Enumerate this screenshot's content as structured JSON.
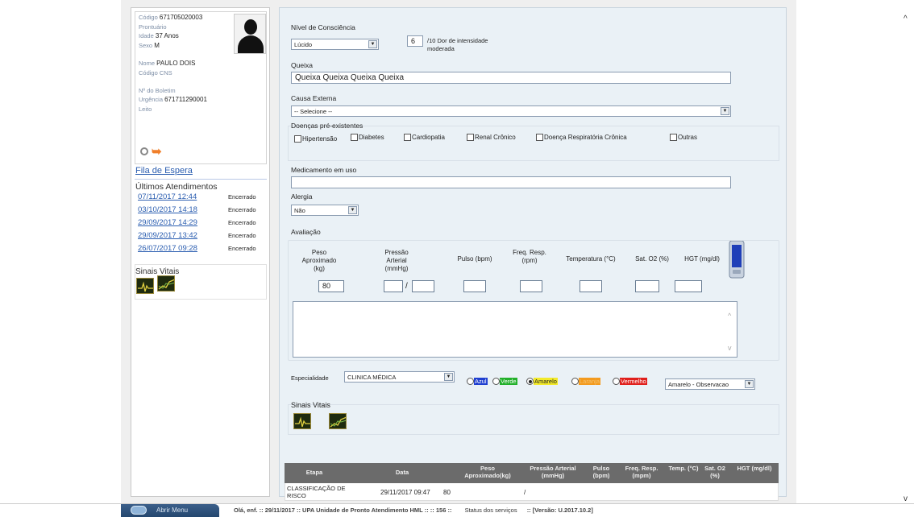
{
  "patient": {
    "codigo_label": "Código",
    "codigo": "671705020003",
    "prontuario_label": "Prontuário",
    "idade_label": "Idade",
    "idade": "37 Anos",
    "sexo_label": "Sexo",
    "sexo": "M",
    "nome_label": "Nome",
    "nome": "PAULO DOIS",
    "cns_label": "Código CNS",
    "boletim_label": "Nº do Boletim",
    "urgencia_label": "Urgência",
    "urgencia": "671711290001",
    "leito_label": "Leito"
  },
  "fila_label": "Fila de Espera",
  "ultimos": {
    "title": "Últimos Atendimentos",
    "items": [
      {
        "date": "07/11/2017 12:44",
        "status": "Encerrado"
      },
      {
        "date": "03/10/2017 14:18",
        "status": "Encerrado"
      },
      {
        "date": "29/09/2017 14:29",
        "status": "Encerrado"
      },
      {
        "date": "29/09/2017 13:42",
        "status": "Encerrado"
      },
      {
        "date": "26/07/2017 09:28",
        "status": "Encerrado"
      }
    ]
  },
  "sinais_label": "Sinais Vitais",
  "form": {
    "nivel_label": "Nível de Consciência",
    "nivel_value": "Lúcido",
    "dor_value": "6",
    "dor_text": "/10 Dor de intensidade",
    "dor_text2": "moderada",
    "queixa_label": "Queixa",
    "queixa_value": "Queixa Queixa Queixa Queixa",
    "causa_label": "Causa Externa",
    "causa_value": "-- Selecione --",
    "doencas_label": "Doenças pré-existentes",
    "doencas": [
      "Hipertensão",
      "Diabetes",
      "Cardiopatia",
      "Renal Crônico",
      "Doença Respiratória Crônica",
      "Outras"
    ],
    "medicamento_label": "Medicamento em uso",
    "alergia_label": "Alergia",
    "alergia_value": "Não",
    "avaliacao_label": "Avaliação",
    "vitals": {
      "peso_label": "Peso Aproximado (kg)",
      "pressao_label": "Pressão Arterial (mmHg)",
      "pulso_label": "Pulso (bpm)",
      "freq_label": "Freq. Resp. (rpm)",
      "temp_label": "Temperatura (°C)",
      "sat_label": "Sat. O2 (%)",
      "hgt_label": "HGT (mg/dl)",
      "peso_value": "80",
      "pressao_sep": "/"
    },
    "especialidade_label": "Especialidade",
    "especialidade_value": "CLINICA MÉDICA",
    "cores": [
      {
        "label": "Azul",
        "bg": "#1f3fd0",
        "fg": "#ffffff",
        "checked": false
      },
      {
        "label": "Verde",
        "bg": "#23b02b",
        "fg": "#ffffff",
        "checked": false
      },
      {
        "label": "Amarelo",
        "bg": "#f3ea2a",
        "fg": "#222222",
        "checked": true
      },
      {
        "label": "Laranja",
        "bg": "#f39a1e",
        "fg": "#f3c270",
        "checked": false
      },
      {
        "label": "Vermelho",
        "bg": "#e0201c",
        "fg": "#ffffff",
        "checked": false
      }
    ],
    "classif_value": "Amarelo - Observacao",
    "sinais_label": "Sinais Vitais"
  },
  "table": {
    "headers": [
      "Etapa",
      "Data",
      "Peso Aproximado(kg)",
      "Pressão Arterial (mmHg)",
      "Pulso (bpm)",
      "Freq. Resp. (mpm)",
      "Temp. (°C)",
      "Sat. O2 (%)",
      "HGT (mg/dl)"
    ],
    "rows": [
      {
        "etapa": "CLASSIFICAÇÃO DE RISCO",
        "data": "29/11/2017 09:47",
        "peso": "80",
        "pressao": "/"
      }
    ]
  },
  "bottom": {
    "menu": "Abrir Menu",
    "status": "Olá, enf.  ::  29/11/2017  ::  UPA Unidade de Pronto Atendimento HML  ::    ::  156  ::",
    "servicos": "Status dos serviços",
    "versao": ":: [Versão: U.2017.10.2]"
  }
}
